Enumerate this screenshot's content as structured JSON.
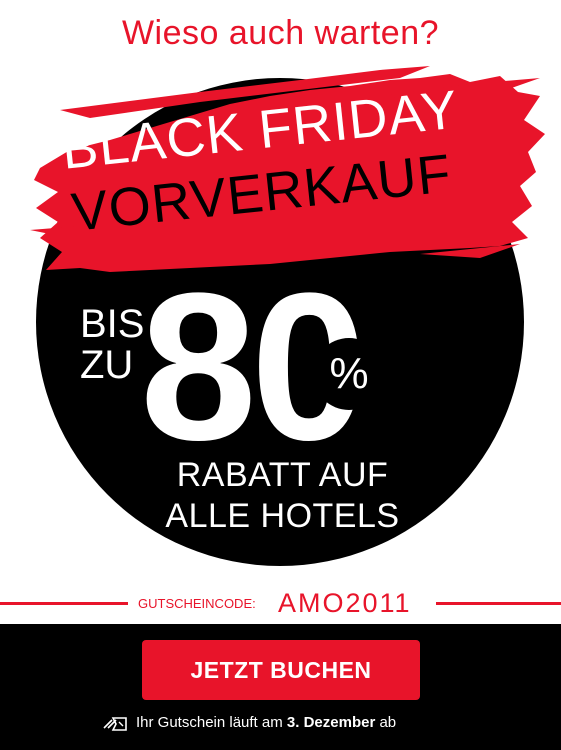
{
  "headline": "Wieso auch warten?",
  "banner": {
    "line1": "BLACK FRIDAY",
    "line2": "VORVERKAUF"
  },
  "discount": {
    "prefix_line1": "BIS",
    "prefix_line2": "ZU",
    "number": "80",
    "percent_sign": "%",
    "subtitle_line1": "RABATT AUF",
    "subtitle_line2": "ALLE HOTELS"
  },
  "voucher": {
    "label": "GUTSCHEINCODE:",
    "code": "AMO2011"
  },
  "cta": {
    "label": "JETZT BUCHEN"
  },
  "expiry": {
    "text_before": "Ihr Gutschein läuft am ",
    "date": "3. Dezember",
    "text_after": " ab",
    "icon": "ticket-icon"
  },
  "colors": {
    "accent": "#e8142a",
    "dark": "#000000",
    "light": "#ffffff"
  }
}
